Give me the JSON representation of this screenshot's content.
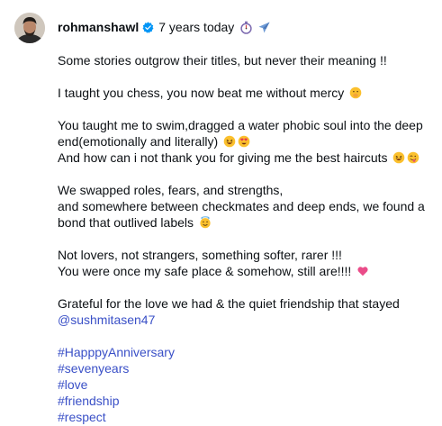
{
  "post": {
    "username": "rohmanshawl",
    "time_text": "7 years today",
    "header_icons": [
      "stopwatch-icon",
      "airplane-icon"
    ],
    "lines": {
      "l1": "Some stories outgrow their titles, but never their meaning !!",
      "l2": "I taught you chess, you now beat me without mercy",
      "l3a": "You taught me to swim,dragged a water phobic soul into the deep",
      "l3b": "end(emotionally and literally)",
      "l4": "And how can i not thank you for giving me the best haircuts",
      "l5a": "We swapped roles, fears, and strengths,",
      "l5b": "and somewhere between checkmates and deep ends, we found a",
      "l5c": "bond that outlived labels",
      "l6a": "Not lovers, not strangers, something softer, rarer !!!",
      "l6b": "You were once my safe place & somehow, still are!!!!",
      "l7": "Grateful for the love we had & the quiet friendship that stayed"
    },
    "mention": "@sushmitasen47",
    "hashtags": [
      "#HapppyAnniversary",
      "#sevenyears",
      "#love",
      "#friendship",
      "#respect"
    ],
    "colors": {
      "text": "#0c1014",
      "link": "#3a50c7",
      "verified": "#0095f6"
    }
  }
}
